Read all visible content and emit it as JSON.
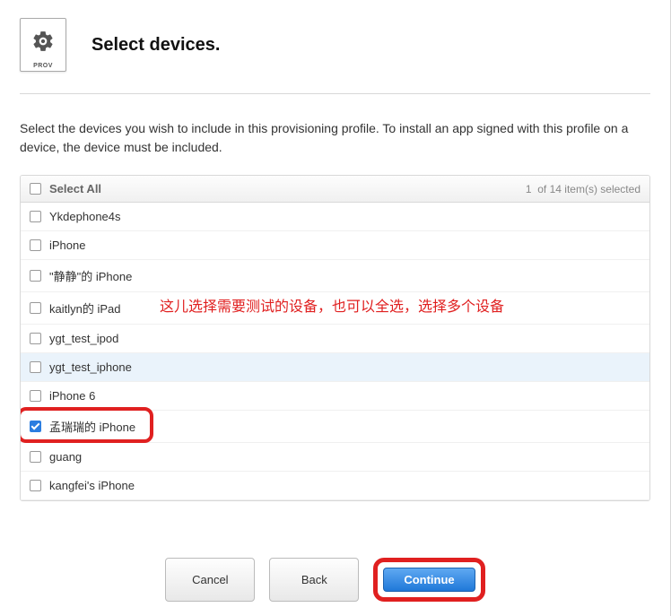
{
  "header": {
    "icon_label": "PROV",
    "title": "Select devices."
  },
  "description": "Select the devices you wish to include in this provisioning profile. To install an app signed with this profile on a device, the device must be included.",
  "list": {
    "select_all_label": "Select All",
    "selected_count": "1",
    "total_count": "14",
    "count_suffix": "item(s) selected",
    "items": [
      {
        "name": "Ykdephone4s",
        "checked": false,
        "highlighted": false
      },
      {
        "name": "iPhone",
        "checked": false,
        "highlighted": false
      },
      {
        "name": "\"静静\"的 iPhone",
        "checked": false,
        "highlighted": false
      },
      {
        "name": "kaitlyn的 iPad",
        "checked": false,
        "highlighted": false
      },
      {
        "name": "ygt_test_ipod",
        "checked": false,
        "highlighted": false
      },
      {
        "name": "ygt_test_iphone",
        "checked": false,
        "highlighted": true
      },
      {
        "name": "iPhone 6",
        "checked": false,
        "highlighted": false
      },
      {
        "name": "孟瑞瑞的 iPhone",
        "checked": true,
        "highlighted": false,
        "red_box": true
      },
      {
        "name": "guang",
        "checked": false,
        "highlighted": false
      },
      {
        "name": "kangfei's iPhone",
        "checked": false,
        "highlighted": false
      }
    ]
  },
  "annotation": "这儿选择需要测试的设备，也可以全选，选择多个设备",
  "buttons": {
    "cancel": "Cancel",
    "back": "Back",
    "continue": "Continue"
  }
}
